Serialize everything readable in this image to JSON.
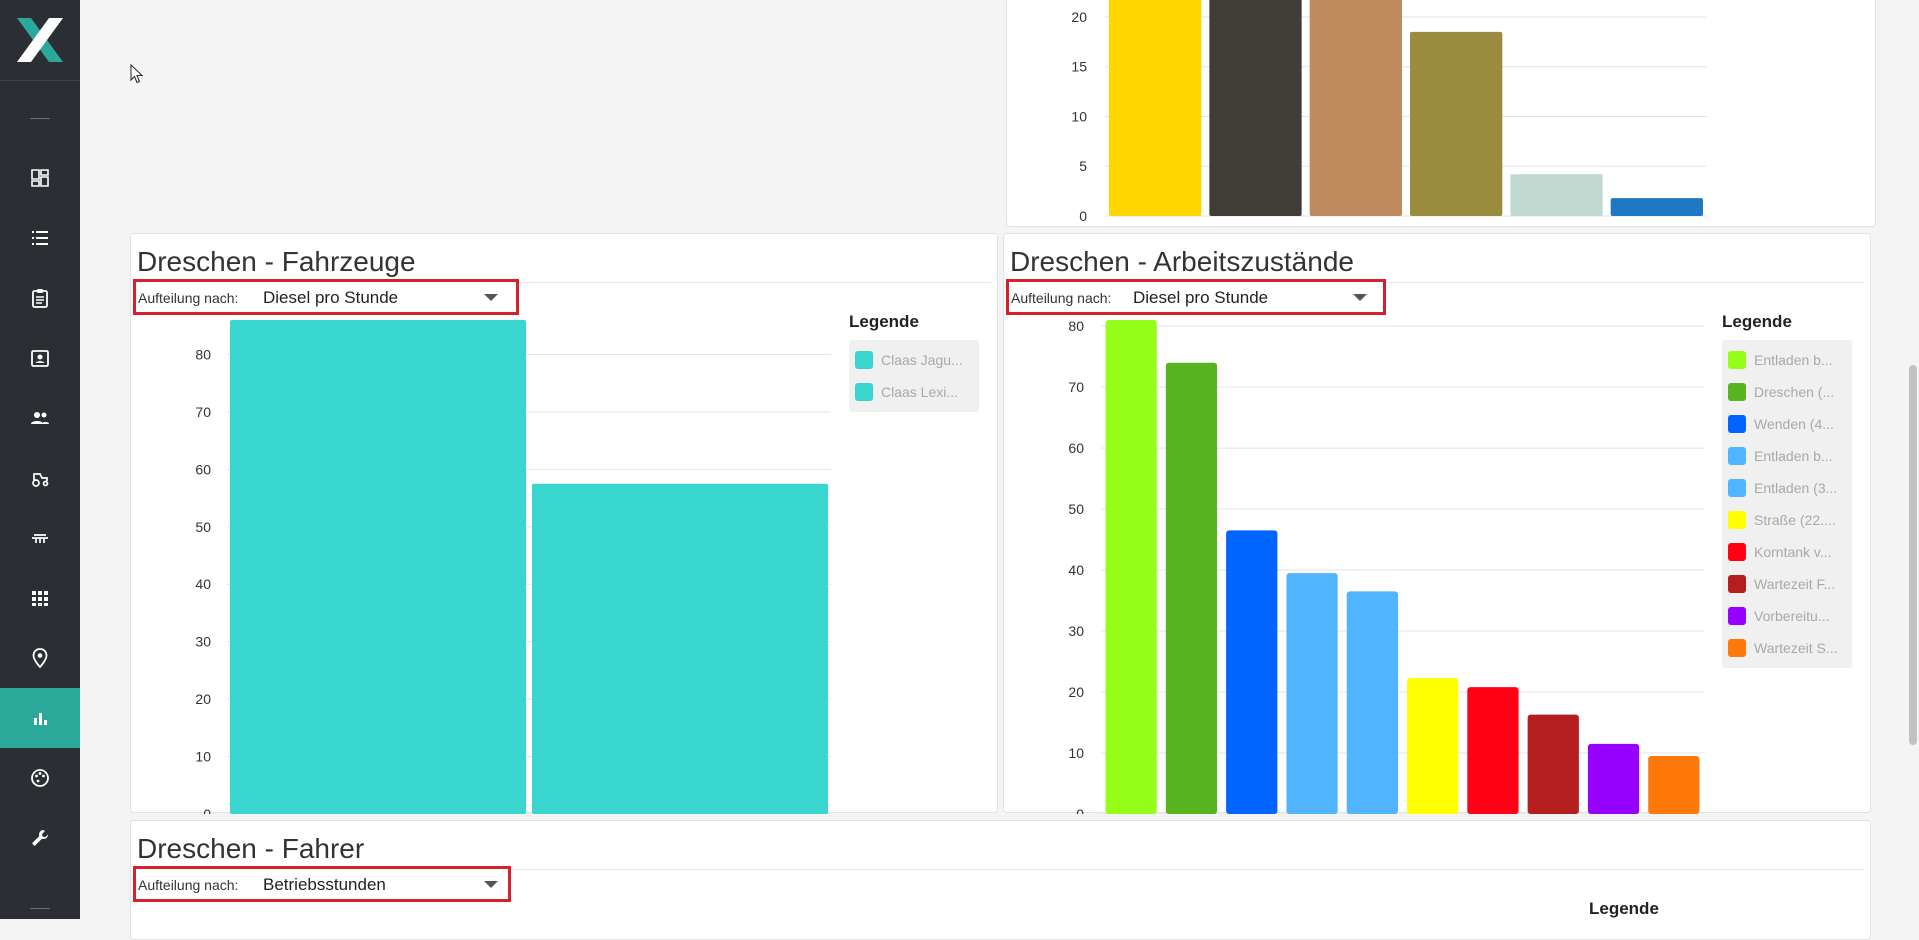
{
  "sidebar": {
    "items": [
      {
        "name": "dashboard-icon"
      },
      {
        "name": "list-icon"
      },
      {
        "name": "clipboard-icon"
      },
      {
        "name": "contact-card-icon"
      },
      {
        "name": "group-icon"
      },
      {
        "name": "tractor-icon"
      },
      {
        "name": "implement-icon"
      },
      {
        "name": "grid-icon"
      },
      {
        "name": "location-pin-icon"
      },
      {
        "name": "bar-chart-icon",
        "active": true
      },
      {
        "name": "palette-icon"
      },
      {
        "name": "wrench-icon"
      }
    ],
    "active_color": "#2ba89a"
  },
  "split_label": "Aufteilung nach:",
  "legend_title": "Legende",
  "top_chart": {
    "chart_data": {
      "type": "bar",
      "yticks": [
        0,
        5,
        10,
        15,
        20
      ],
      "ylim": [
        0,
        21
      ],
      "values": [
        22.5,
        22.5,
        22.5,
        18.5,
        4.2,
        1.8
      ],
      "colors": [
        "#ffd600",
        "#403c37",
        "#bf8b5e",
        "#9a8b3e",
        "#c0d9d1",
        "#1e78c2"
      ]
    }
  },
  "fahrzeuge": {
    "title": "Dreschen - Fahrzeuge",
    "split_value": "Diesel pro Stunde",
    "chart_data": {
      "type": "bar",
      "yticks": [
        0,
        10,
        20,
        30,
        40,
        50,
        60,
        70,
        80
      ],
      "ylim": [
        0,
        86
      ],
      "values": [
        86,
        57.5
      ],
      "colors": [
        "#38d6cf",
        "#38d6cf"
      ]
    },
    "legend": [
      {
        "label": "Claas Jagu...",
        "color": "#38d6cf"
      },
      {
        "label": "Claas Lexi...",
        "color": "#38d6cf"
      }
    ]
  },
  "arbeitszustaende": {
    "title": "Dreschen - Arbeitszustände",
    "split_value": "Diesel pro Stunde",
    "chart_data": {
      "type": "bar",
      "yticks": [
        0,
        10,
        20,
        30,
        40,
        50,
        60,
        70,
        80
      ],
      "ylim": [
        0,
        81
      ],
      "values": [
        81,
        74,
        46.5,
        39.5,
        36.5,
        22.3,
        20.8,
        16.3,
        11.5,
        9.5
      ],
      "colors": [
        "#96ff1a",
        "#57b41e",
        "#0064ff",
        "#50b4ff",
        "#50b4ff",
        "#ffff00",
        "#ff0014",
        "#b41e1e",
        "#9600ff",
        "#ff780a"
      ]
    },
    "legend": [
      {
        "label": "Entladen b...",
        "color": "#96ff1a"
      },
      {
        "label": "Dreschen (...",
        "color": "#57b41e"
      },
      {
        "label": "Wenden (4...",
        "color": "#0064ff"
      },
      {
        "label": "Entladen b...",
        "color": "#50b4ff"
      },
      {
        "label": "Entladen (3...",
        "color": "#50b4ff"
      },
      {
        "label": "Straße (22....",
        "color": "#ffff00"
      },
      {
        "label": "Korntank v...",
        "color": "#ff0014"
      },
      {
        "label": "Wartezeit F...",
        "color": "#b41e1e"
      },
      {
        "label": "Vorbereitu...",
        "color": "#9600ff"
      },
      {
        "label": "Wartezeit S...",
        "color": "#ff780a"
      }
    ]
  },
  "fahrer": {
    "title": "Dreschen - Fahrer",
    "split_value": "Betriebsstunden"
  }
}
